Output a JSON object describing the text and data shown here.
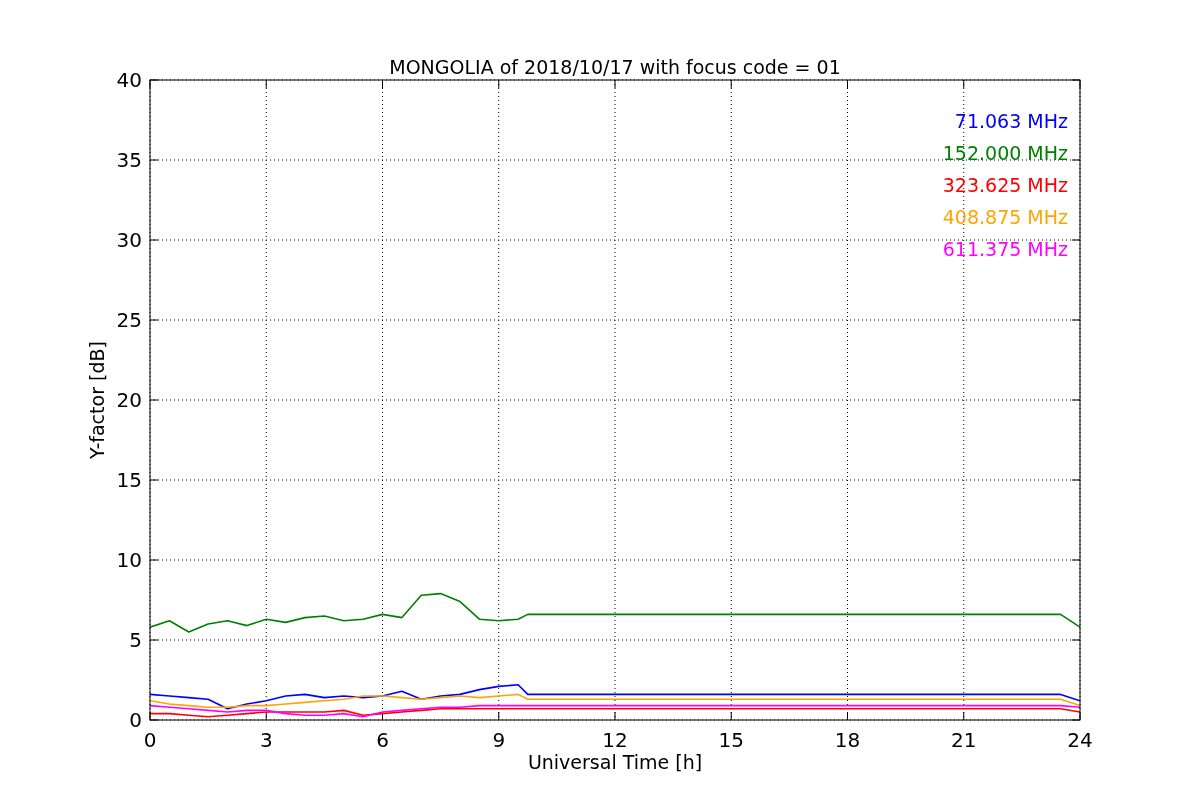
{
  "chart_data": {
    "type": "line",
    "grid": true,
    "title": "MONGOLIA of 2018/10/17 with focus code = 01",
    "xlabel": "Universal Time [h]",
    "ylabel": "Y-factor [dB]",
    "xlim": [
      0,
      24
    ],
    "ylim": [
      0,
      40
    ],
    "xticks": [
      0,
      3,
      6,
      9,
      12,
      15,
      18,
      21,
      24
    ],
    "yticks": [
      0,
      5,
      10,
      15,
      20,
      25,
      30,
      35,
      40
    ],
    "x": [
      0,
      0.5,
      1,
      1.5,
      2,
      2.5,
      3,
      3.5,
      4,
      4.5,
      5,
      5.5,
      6,
      6.5,
      7,
      7.5,
      8,
      8.5,
      9,
      9.5,
      9.75,
      23.5,
      24
    ],
    "series": [
      {
        "name": "71.063 MHz",
        "color": "#0000ff",
        "values": [
          1.6,
          1.5,
          1.4,
          1.3,
          0.7,
          1.0,
          1.2,
          1.5,
          1.6,
          1.4,
          1.5,
          1.4,
          1.5,
          1.8,
          1.3,
          1.5,
          1.6,
          1.9,
          2.1,
          2.2,
          1.6,
          1.6,
          1.2
        ]
      },
      {
        "name": "152.000 MHz",
        "color": "#008000",
        "values": [
          5.8,
          6.2,
          5.5,
          6.0,
          6.2,
          5.9,
          6.3,
          6.1,
          6.4,
          6.5,
          6.2,
          6.3,
          6.6,
          6.4,
          7.8,
          7.9,
          7.4,
          6.3,
          6.2,
          6.3,
          6.6,
          6.6,
          5.8
        ]
      },
      {
        "name": "323.625 MHz",
        "color": "#ff0000",
        "values": [
          0.4,
          0.4,
          0.3,
          0.2,
          0.3,
          0.4,
          0.5,
          0.5,
          0.5,
          0.5,
          0.6,
          0.3,
          0.4,
          0.5,
          0.6,
          0.7,
          0.7,
          0.7,
          0.7,
          0.7,
          0.7,
          0.7,
          0.5
        ]
      },
      {
        "name": "408.875 MHz",
        "color": "#ffa500",
        "values": [
          1.2,
          1.0,
          0.9,
          0.8,
          0.8,
          0.9,
          0.9,
          1.0,
          1.1,
          1.2,
          1.3,
          1.5,
          1.5,
          1.4,
          1.3,
          1.4,
          1.5,
          1.4,
          1.5,
          1.6,
          1.3,
          1.3,
          0.9
        ]
      },
      {
        "name": "611.375 MHz",
        "color": "#ff00ff",
        "values": [
          0.9,
          0.8,
          0.7,
          0.6,
          0.5,
          0.6,
          0.6,
          0.4,
          0.3,
          0.3,
          0.4,
          0.2,
          0.5,
          0.6,
          0.7,
          0.8,
          0.8,
          0.9,
          0.9,
          0.9,
          0.9,
          0.9,
          0.8
        ]
      }
    ]
  }
}
